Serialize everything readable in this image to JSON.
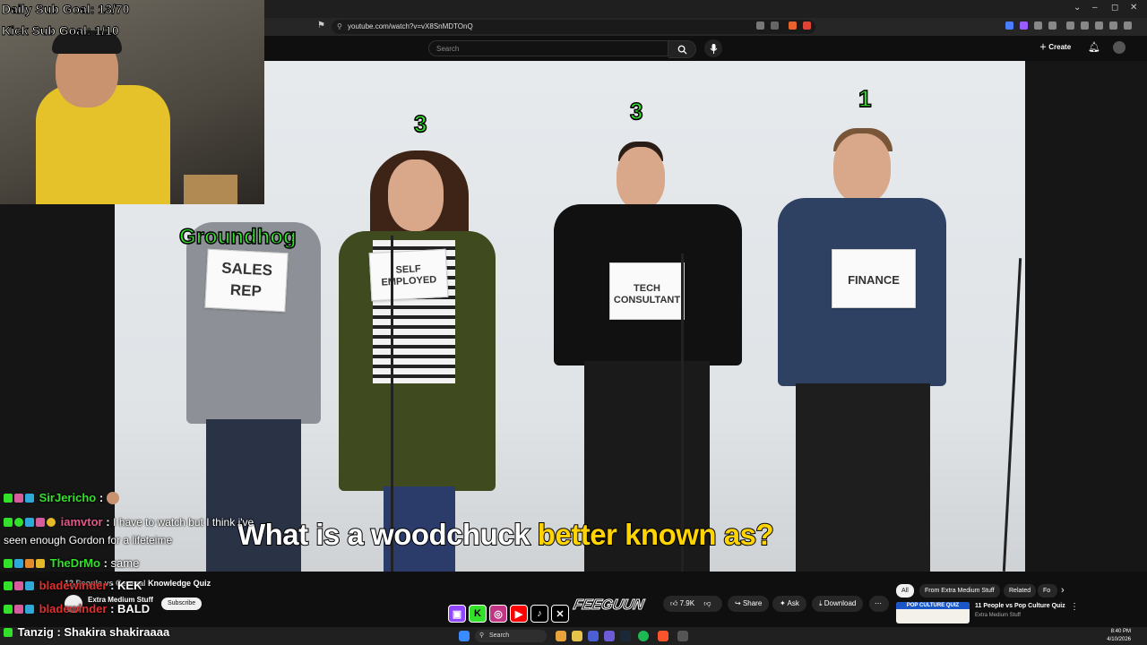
{
  "browser": {
    "url": "youtube.com/watch?v=vX8SnMDTOnQ",
    "window_controls": [
      "⌄",
      "–",
      "◻",
      "✕"
    ]
  },
  "youtube": {
    "search_placeholder": "Search",
    "create_label": "Create"
  },
  "stream_overlay": {
    "daily_sub_goal": "Daily Sub Goal: 13/70",
    "kick_sub_goal": "Kick Sub Goal: 1/10",
    "social_handle": "FEEGUUN"
  },
  "video": {
    "caption_part1": "What is a woodchuck ",
    "caption_part2": "better known as?",
    "answer_label": "Groundhog",
    "contestants": [
      {
        "sign": "SALES REP",
        "score": ""
      },
      {
        "sign": "SELF EMPLOYED",
        "score": "3"
      },
      {
        "sign": "TECH CONSULTANT",
        "score": "3"
      },
      {
        "sign": "FINANCE",
        "score": "1"
      }
    ]
  },
  "chat": [
    {
      "user": "SirJericho",
      "message": "",
      "color": "#33e02a"
    },
    {
      "user": "iamvtor",
      "message": "I have to watch but I think i've",
      "color": "#e0598b"
    },
    {
      "user": "",
      "message": "seen enough Gordon for a lifeteime",
      "color": "#fff"
    },
    {
      "user": "TheDrMo",
      "message": "same",
      "color": "#33e02a"
    },
    {
      "user": "bladewinder",
      "message": "KEK",
      "color": "#e03030"
    },
    {
      "user": "bladewinder",
      "message": "BALD",
      "color": "#e03030"
    },
    {
      "user": "Tanzig",
      "message": "Shakira shakiraaaa",
      "color": "#fff"
    }
  ],
  "watch": {
    "title_fragment": "Knowledge Quiz",
    "channel": "Extra Medium Stuff",
    "subscribe_label": "Subscribe",
    "likes": "7.9K",
    "share_label": "Share",
    "ask_label": "Ask",
    "download_label": "Download",
    "chips": [
      "All",
      "From Extra Medium Stuff",
      "Related",
      "Fo"
    ],
    "next_video_title": "11 People vs Pop Culture Quiz",
    "next_video_channel": "Extra Medium Stuff",
    "next_thumb_text": "POP CULTURE QUIZ"
  },
  "taskbar": {
    "search_label": "Search",
    "time": "8:40 PM",
    "date": "4/10/2026"
  },
  "colors": {
    "green_score": "#33e02a",
    "caption_highlight": "#ffd400",
    "youtube_dark": "#0f0f0f"
  }
}
